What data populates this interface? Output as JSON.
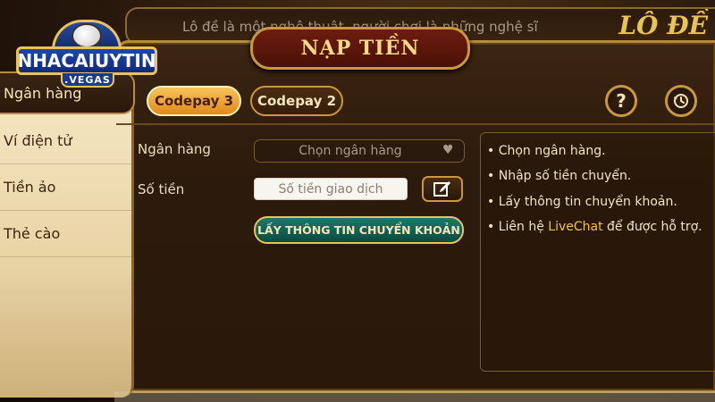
{
  "header": {
    "marquee": "Lô đề là một nghệ thuật, người chơi là những nghệ sĩ",
    "game_title": "LÔ ĐỀ"
  },
  "logo": {
    "main": "NHACAIUYTIN",
    "sub": ".VEGAS"
  },
  "panel": {
    "title": "NẠP TIỀN"
  },
  "sidebar": {
    "items": [
      {
        "label": "Ngân hàng",
        "active": true
      },
      {
        "label": "Ví điện tử",
        "active": false
      },
      {
        "label": "Tiền ảo",
        "active": false
      },
      {
        "label": "Thẻ cào",
        "active": false
      }
    ]
  },
  "tabs": [
    {
      "label": "Codepay 3",
      "active": true
    },
    {
      "label": "Codepay 2",
      "active": false
    }
  ],
  "actions": {
    "help_icon": "question-icon",
    "history_icon": "clock-history-icon"
  },
  "form": {
    "bank_label": "Ngân hàng",
    "bank_placeholder": "Chọn ngân hàng",
    "amount_label": "Số tiền",
    "amount_placeholder": "Số tiền giao dịch",
    "submit_label": "LẤY THÔNG TIN CHUYỂN KHOẢN"
  },
  "instructions": {
    "items": [
      "Chọn ngân hàng.",
      "Nhập số tiền chuyển.",
      "Lấy thông tin chuyển khoản."
    ],
    "support_prefix": "Liên hệ ",
    "support_link": "LiveChat",
    "support_suffix": " để được hỗ trợ."
  },
  "colors": {
    "accent_gold": "#c9973e",
    "highlight": "#f2c43a",
    "active_tab": "#f6c45a",
    "submit_green": "#1a7a6a"
  }
}
